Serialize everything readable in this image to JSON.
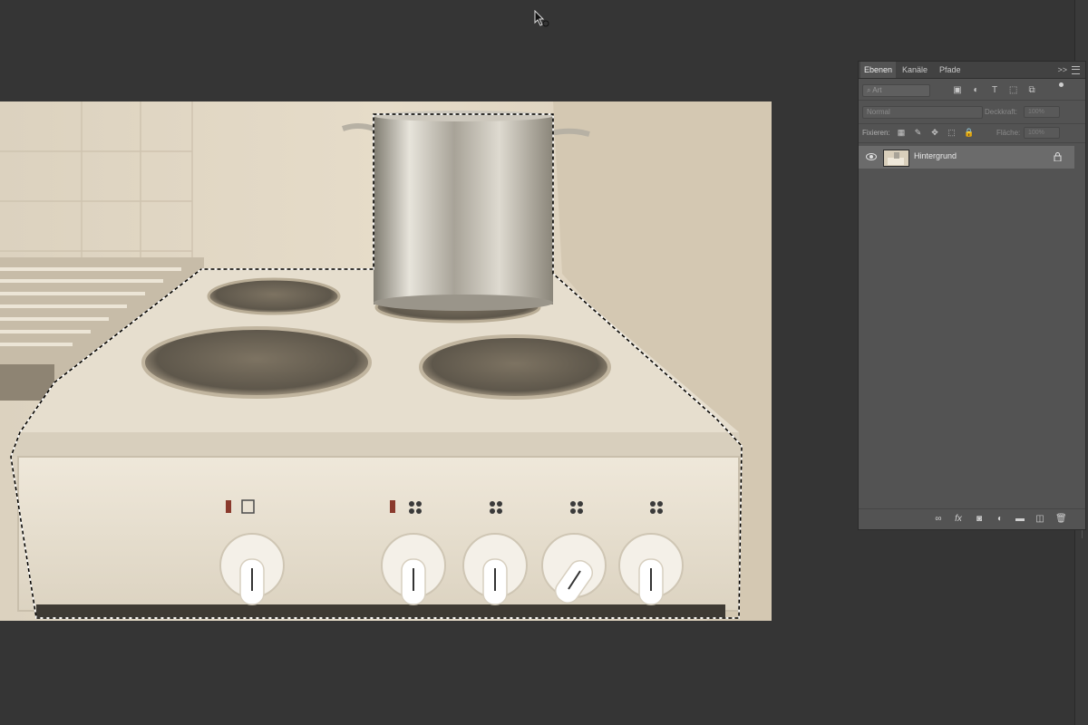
{
  "document": {
    "name": "Hintergrund"
  },
  "layers_panel": {
    "tabs": [
      {
        "label": "Ebenen"
      },
      {
        "label": "Kanäle"
      },
      {
        "label": "Pfade"
      }
    ],
    "collapse_label": ">>",
    "filter": {
      "placeholder": "Art",
      "icons": [
        "image-filter-icon",
        "adjustment-filter-icon",
        "text-filter-icon",
        "shape-filter-icon",
        "smart-object-filter-icon"
      ]
    },
    "blend_mode": "Normal",
    "opacity_label": "Deckkraft:",
    "opacity_value": "100%",
    "lock_label": "Fixieren:",
    "fill_label": "Fläche:",
    "fill_value": "100%",
    "layers": [
      {
        "name": "Hintergrund",
        "visible": true,
        "locked": true
      }
    ],
    "footer_icons": [
      "link-icon",
      "fx-icon",
      "mask-icon",
      "adjustment-icon",
      "folder-icon",
      "new-layer-icon",
      "trash-icon"
    ],
    "footer_fx": "fx"
  },
  "colors": {
    "workspace": "#353535",
    "panel": "#535353",
    "selected_layer": "#6b6b6b"
  }
}
